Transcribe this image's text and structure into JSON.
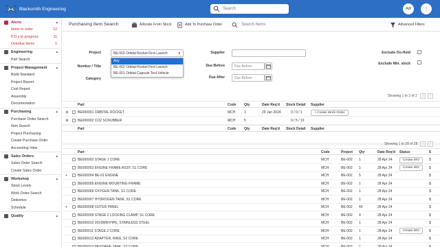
{
  "app": {
    "title": "Blacksmith Engineering",
    "search_placeholder": "Search",
    "avatar": "AW",
    "menu_icon": "vertical-ellipsis"
  },
  "sidebar": {
    "alerts": {
      "label": "Alerts",
      "items": [
        {
          "label": "Items to order",
          "count": "12"
        },
        {
          "label": "P.O.s to progress",
          "count": "11"
        },
        {
          "label": "Overdue Items",
          "count": "1"
        }
      ]
    },
    "sections": [
      {
        "label": "Engineering",
        "items": [
          "Part Search"
        ]
      },
      {
        "label": "Project Management",
        "items": [
          "Build Standard",
          "Project Report",
          "Cost Report",
          "Assembly",
          "Documentation"
        ]
      },
      {
        "label": "Purchasing",
        "items": [
          "Purchase Order Search",
          "Item Search",
          "Project Purchasing",
          "Create Purchase Order",
          "Accounting View"
        ]
      },
      {
        "label": "Sales Orders",
        "items": [
          "Sales Order Search",
          "Create Sales Order"
        ]
      },
      {
        "label": "Workshop",
        "items": [
          "Stock Levels",
          "Work Order Search",
          "Deliveries",
          "Schedule"
        ]
      },
      {
        "label": "Quality",
        "items": []
      }
    ]
  },
  "toolbar": {
    "title": "Purchasing Item Search",
    "allocate_label": "Allocate From Stock",
    "add_po_label": "Add To Purchase Order",
    "search_placeholder": "Search Items",
    "advanced_label": "Advanced Filters"
  },
  "filters": {
    "project_label": "Project",
    "project_value": "BE-002 Orbital Rocket First Launch",
    "project_options": [
      "Any",
      "BE-002 Orbital Rocket First Launch",
      "BE-001 Orbital Capsule Test Vehicle"
    ],
    "number_title_label": "Number / Title",
    "category_label": "Category",
    "supplier_label": "Supplier",
    "due_before_label": "Due Before",
    "due_before_placeholder": "Due Before",
    "due_after_label": "Due After",
    "due_after_placeholder": "Due Before",
    "exclude_on_hold_label": "Exclude On-Hold",
    "exclude_min_stock_label": "Exclude Min. stock"
  },
  "table1": {
    "showing": "Showing 1 to 2 of 2",
    "columns": [
      "Part",
      "Code",
      "Qty",
      "Date Req'd",
      "Stock Detail",
      "Supplier"
    ],
    "rows": [
      {
        "part": "BE000001 ORBITAL ROCKET",
        "code": "MCH",
        "qty": "1",
        "date": "29 Jan 2024",
        "stock": "0 / 0 / 1",
        "action": "+ Create Work Order"
      },
      {
        "part": "BE000002 CO2 SCRUBBER",
        "code": "MCH",
        "qty": "5",
        "date": "",
        "stock": "0 / 5 / 10",
        "action": ""
      }
    ]
  },
  "table2": {
    "showing": "Showing 1 to 28 of 28",
    "columns": [
      "Part",
      "Code",
      "Project",
      "Qty",
      "Date Req'd",
      "Status",
      "$"
    ],
    "rows": [
      {
        "part": "BE000002 STAGE 1 CORE",
        "code": "MCH",
        "project": "BE-002",
        "qty": "1",
        "date": "28 Apr 24",
        "action": "Create WO",
        "plus": false
      },
      {
        "part": "BE000003 ENGINE FRAME ASSY, S1 CORE",
        "code": "MCH",
        "project": "BE-002",
        "qty": "1",
        "date": "28 Apr 24",
        "action": "Create WO",
        "plus": false
      },
      {
        "part": "BE000004 BE-01 ENGINE",
        "code": "MCH",
        "project": "BE-002",
        "qty": "5",
        "date": "28 Apr 24",
        "action": "",
        "plus": true
      },
      {
        "part": "BE000005 ENGINE MOUNTING FRAME",
        "code": "MCH",
        "project": "BE-002",
        "qty": "1",
        "date": "28 Apr 24",
        "action": "",
        "plus": false
      },
      {
        "part": "BE000006 OXYGEN TANK, S1 CORE",
        "code": "MCH",
        "project": "BE-002",
        "qty": "1",
        "date": "28 Apr 24",
        "action": "",
        "plus": false
      },
      {
        "part": "BE000007 HYDROGEN TANK, S1 CORE",
        "code": "MCH",
        "project": "BE-002",
        "qty": "1",
        "date": "28 Apr 24",
        "action": "",
        "plus": false
      },
      {
        "part": "BE000008 OUTER PANEL",
        "code": "MCH",
        "project": "BE-002",
        "qty": "40",
        "date": "28 Apr 24",
        "action": "",
        "plus": true
      },
      {
        "part": "BE000009 STAGE 2 LOCKING CLAMP, S1 CORE",
        "code": "MCH",
        "project": "BE-002",
        "qty": "4",
        "date": "28 Apr 24",
        "action": "",
        "plus": false
      },
      {
        "part": "BE000010 20X3MM PIPE, STAINLESS STEEL",
        "code": "MCH",
        "project": "BE-002",
        "qty": "1",
        "date": "28 Apr 24",
        "action": "",
        "plus": false
      },
      {
        "part": "BE000011 STAGE 2 CORE",
        "code": "MCH",
        "project": "BE-002",
        "qty": "1",
        "date": "28 Apr 24",
        "action": "Create WO",
        "plus": false
      },
      {
        "part": "BE000012 ADAPTER, RING, S2 CORE",
        "code": "MCH",
        "project": "BE-002",
        "qty": "1",
        "date": "28 Apr 24",
        "action": "",
        "plus": false
      },
      {
        "part": "BE000013 METHANE TANK, S2 CORE",
        "code": "MCH",
        "project": "BE-002",
        "qty": "1",
        "date": "28 Apr 24",
        "action": "",
        "plus": false
      }
    ]
  }
}
